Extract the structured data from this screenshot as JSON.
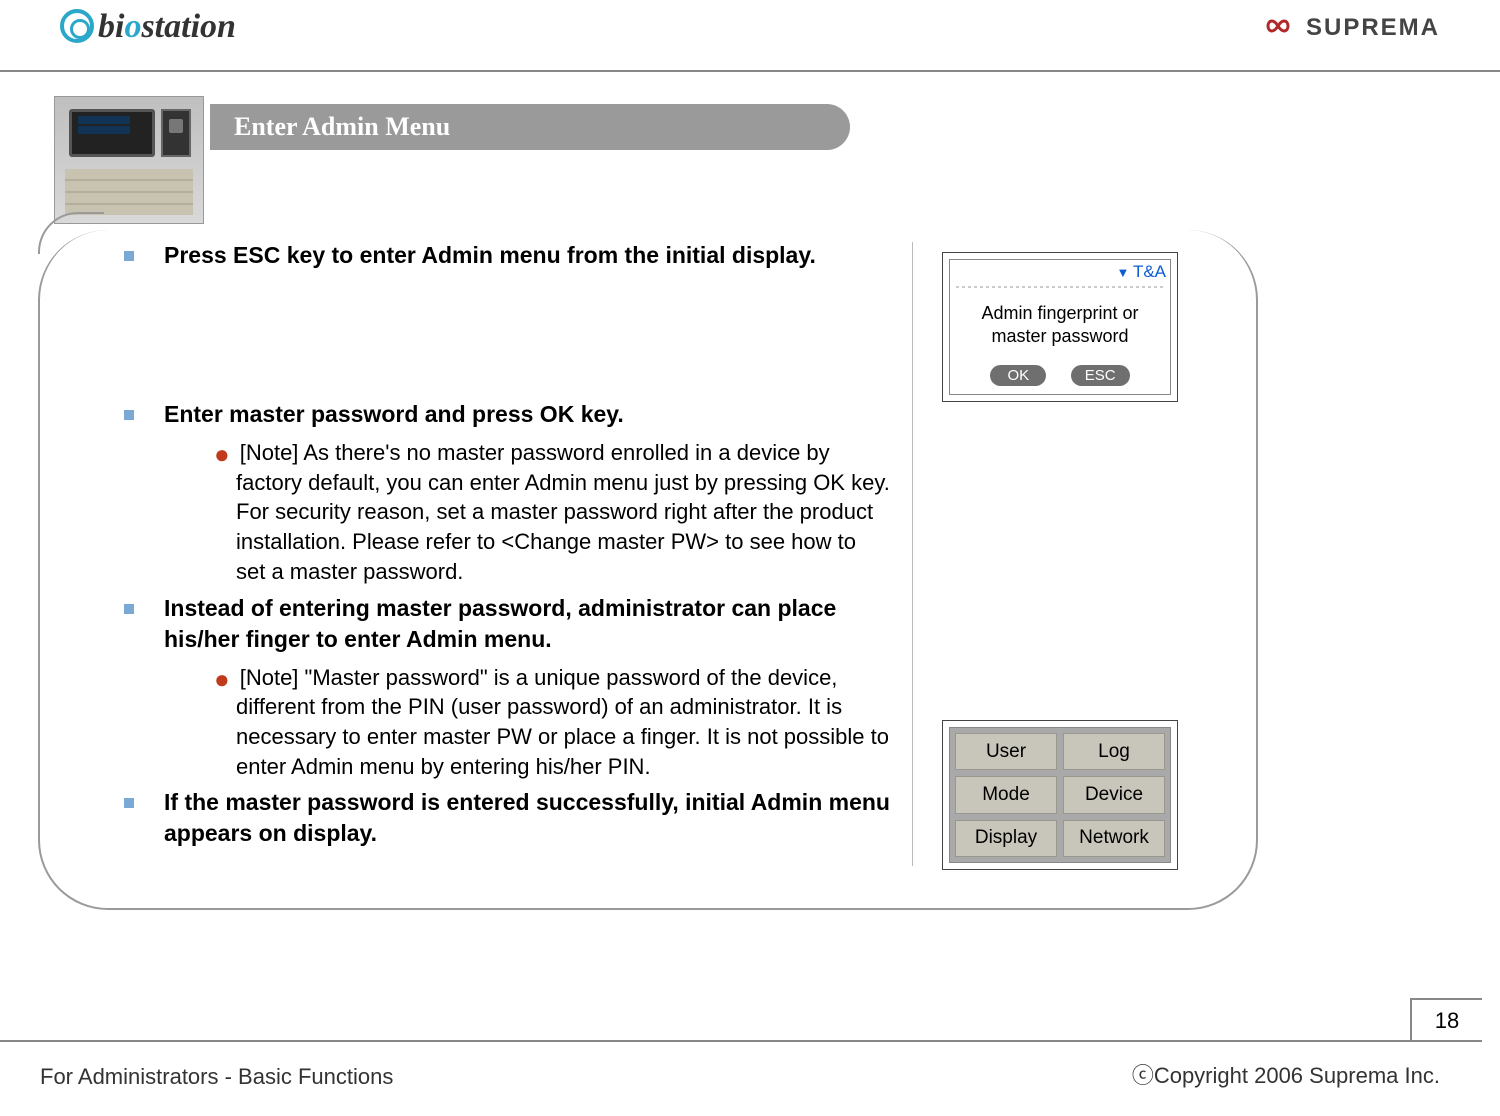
{
  "header": {
    "left_logo_text_pre": "bi",
    "left_logo_text_accent": "o",
    "left_logo_text_post": "station",
    "right_logo_text": "SUPREMA"
  },
  "title": "Enter Admin Menu",
  "bullets": {
    "b1": "Press ESC key to enter Admin menu from the initial display.",
    "b2": "Enter master password and press OK key.",
    "b2_note": "[Note] As there's no master password enrolled in a device by factory default, you can enter Admin menu just by pressing OK key. For security reason, set a master password right after the product installation. Please refer to <Change master PW> to see how to set a master password.",
    "b3": "Instead of entering master password, administrator can place his/her finger to enter Admin menu.",
    "b3_note": "[Note] \"Master password\" is a unique password of the device, different from the PIN (user password) of an administrator. It is necessary to enter master PW or place a finger. It is not possible to enter Admin menu by entering his/her PIN.",
    "b4": "If the master password is entered successfully, initial Admin menu appears on display."
  },
  "screen1": {
    "ta_label": "T&A",
    "message_l1": "Admin fingerprint or",
    "message_l2": "master password",
    "ok": "OK",
    "esc": "ESC"
  },
  "screen2": {
    "cells": [
      "User",
      "Log",
      "Mode",
      "Device",
      "Display",
      "Network"
    ]
  },
  "footer": {
    "left": "For Administrators - Basic Functions",
    "right": "ⓒCopyright 2006 Suprema Inc.",
    "page": "18"
  }
}
